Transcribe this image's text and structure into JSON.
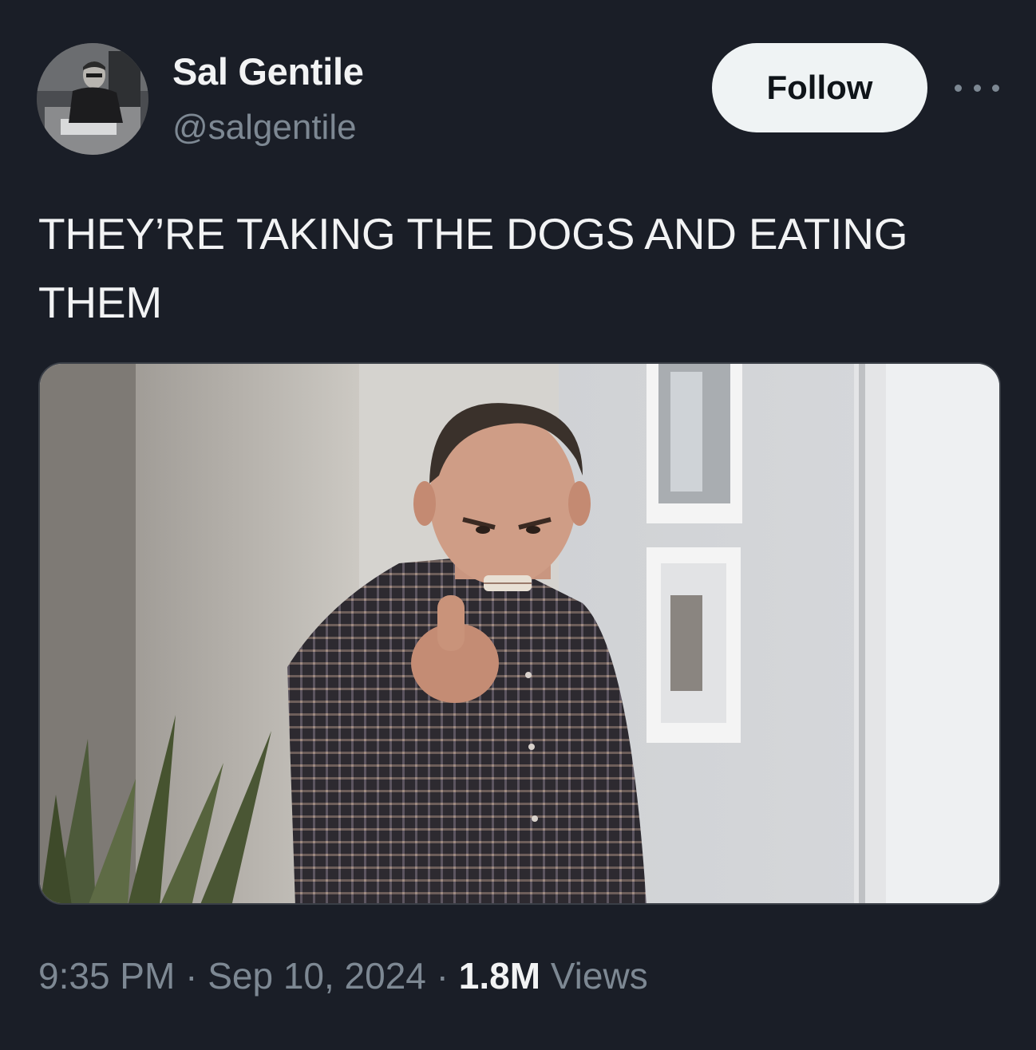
{
  "author": {
    "display_name": "Sal Gentile",
    "handle": "@salgentile",
    "avatar": "profile-photo"
  },
  "actions": {
    "follow_label": "Follow",
    "more_icon": "more-horizontal-icon"
  },
  "tweet": {
    "text": "THEY’RE TAKING THE DOGS AND EATING THEM",
    "media": "photo-man-pointing"
  },
  "meta": {
    "time": "9:35 PM",
    "separator": " · ",
    "date": "Sep 10, 2024",
    "views_count": "1.8M",
    "views_label": " Views"
  },
  "colors": {
    "background": "#1a1e27",
    "text_primary": "#f2f3f4",
    "text_secondary": "#7d8893",
    "follow_button_bg": "#eff3f4",
    "follow_button_text": "#0f1419"
  }
}
